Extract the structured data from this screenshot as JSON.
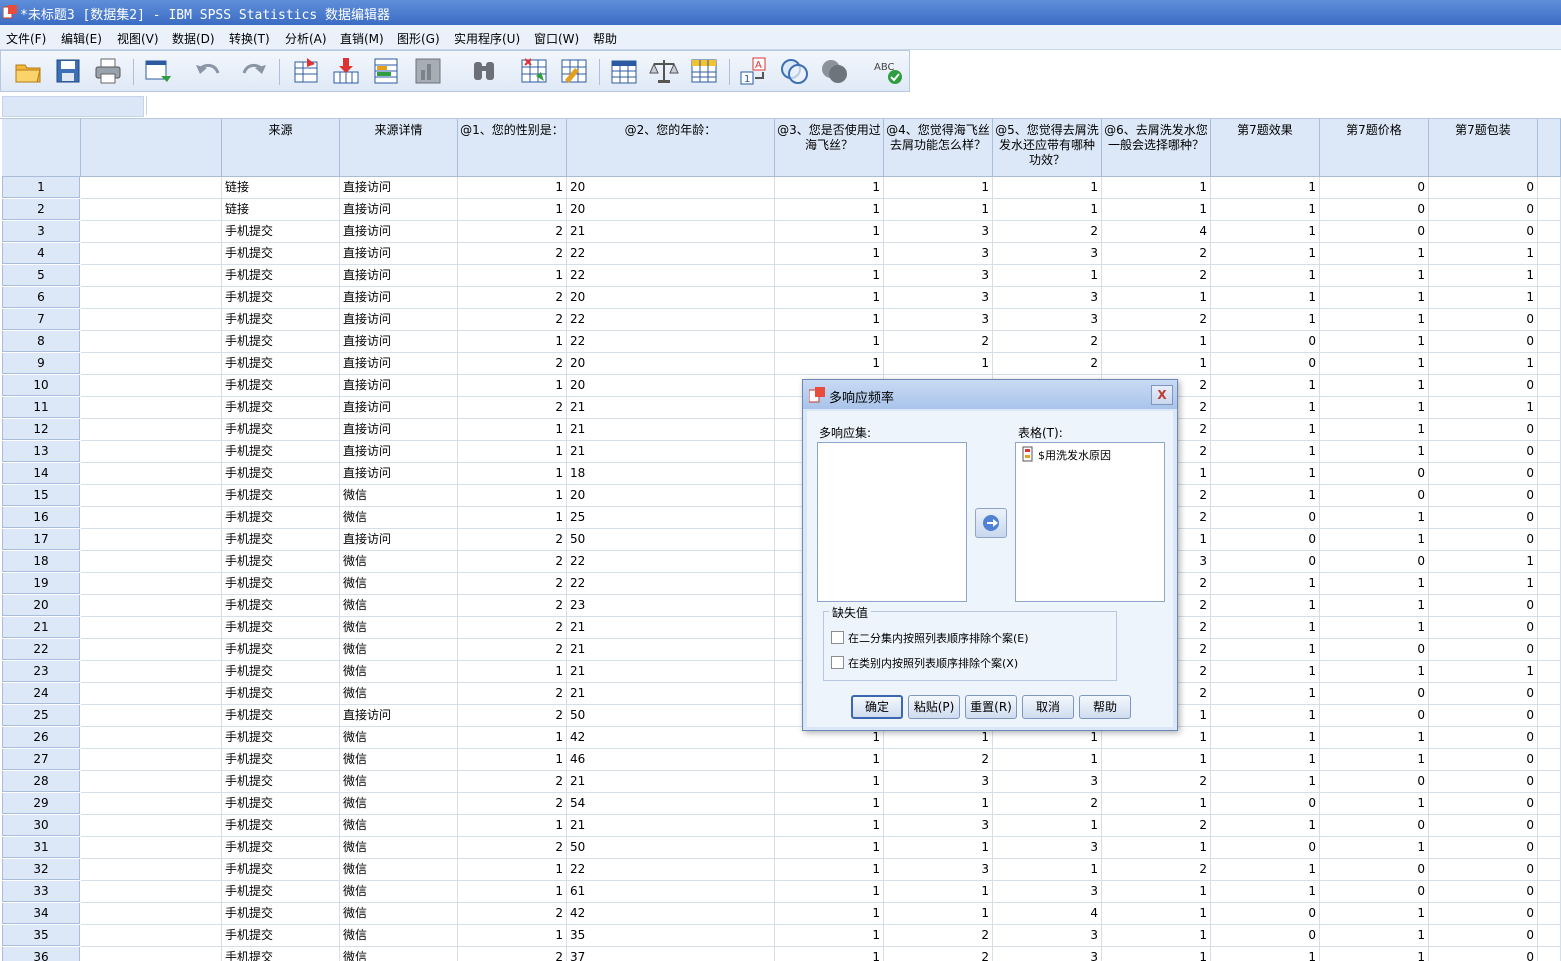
{
  "window": {
    "title": "*未标题3 [数据集2] - IBM SPSS Statistics 数据编辑器"
  },
  "menu": [
    "文件(F)",
    "编辑(E)",
    "视图(V)",
    "数据(D)",
    "转换(T)",
    "分析(A)",
    "直销(M)",
    "图形(G)",
    "实用程序(U)",
    "窗口(W)",
    "帮助"
  ],
  "toolbar_icons": [
    "open-folder-icon",
    "save-icon",
    "print-icon",
    "dialog-recall-icon",
    "undo-icon",
    "redo-icon",
    "goto-case-icon",
    "goto-variable-icon",
    "variables-icon",
    "run-descriptives-icon",
    "find-icon",
    "insert-cases-icon",
    "insert-variable-icon",
    "split-file-icon",
    "weight-cases-icon",
    "select-cases-icon",
    "value-labels-icon",
    "use-variable-sets-icon",
    "show-all-variables-icon",
    "spell-check-icon"
  ],
  "grid": {
    "columns": [
      "",
      "来源",
      "来源详情",
      "@1、您的性别是：",
      "@2、您的年龄：",
      "@3、您是否使用过海飞丝？",
      "@4、您觉得海飞丝去屑功能怎么样？",
      "@5、您觉得去屑洗发水还应带有哪种功效？",
      "@6、去屑洗发水您一般会选择哪种？",
      "第7题效果",
      "第7题价格",
      "第7题包装"
    ],
    "rows": [
      [
        "1",
        "",
        "链接",
        "直接访问",
        "1",
        "20",
        "1",
        "1",
        "1",
        "1",
        "1",
        "0",
        "0"
      ],
      [
        "2",
        "",
        "链接",
        "直接访问",
        "1",
        "20",
        "1",
        "1",
        "1",
        "1",
        "1",
        "0",
        "0"
      ],
      [
        "3",
        "",
        "手机提交",
        "直接访问",
        "2",
        "21",
        "1",
        "3",
        "2",
        "4",
        "1",
        "0",
        "0"
      ],
      [
        "4",
        "",
        "手机提交",
        "直接访问",
        "2",
        "22",
        "1",
        "3",
        "3",
        "2",
        "1",
        "1",
        "1"
      ],
      [
        "5",
        "",
        "手机提交",
        "直接访问",
        "1",
        "22",
        "1",
        "3",
        "1",
        "2",
        "1",
        "1",
        "1"
      ],
      [
        "6",
        "",
        "手机提交",
        "直接访问",
        "2",
        "20",
        "1",
        "3",
        "3",
        "1",
        "1",
        "1",
        "1"
      ],
      [
        "7",
        "",
        "手机提交",
        "直接访问",
        "2",
        "22",
        "1",
        "3",
        "3",
        "2",
        "1",
        "1",
        "0"
      ],
      [
        "8",
        "",
        "手机提交",
        "直接访问",
        "1",
        "22",
        "1",
        "2",
        "2",
        "1",
        "0",
        "1",
        "0"
      ],
      [
        "9",
        "",
        "手机提交",
        "直接访问",
        "2",
        "20",
        "1",
        "1",
        "2",
        "1",
        "0",
        "1",
        "1"
      ],
      [
        "10",
        "",
        "手机提交",
        "直接访问",
        "1",
        "20",
        "",
        "",
        "",
        "2",
        "1",
        "1",
        "0"
      ],
      [
        "11",
        "",
        "手机提交",
        "直接访问",
        "2",
        "21",
        "",
        "",
        "",
        "2",
        "1",
        "1",
        "1"
      ],
      [
        "12",
        "",
        "手机提交",
        "直接访问",
        "1",
        "21",
        "",
        "",
        "",
        "2",
        "1",
        "1",
        "0"
      ],
      [
        "13",
        "",
        "手机提交",
        "直接访问",
        "1",
        "21",
        "",
        "",
        "",
        "2",
        "1",
        "1",
        "0"
      ],
      [
        "14",
        "",
        "手机提交",
        "直接访问",
        "1",
        "18",
        "",
        "",
        "",
        "1",
        "1",
        "0",
        "0"
      ],
      [
        "15",
        "",
        "手机提交",
        "微信",
        "1",
        "20",
        "",
        "",
        "",
        "2",
        "1",
        "0",
        "0"
      ],
      [
        "16",
        "",
        "手机提交",
        "微信",
        "1",
        "25",
        "",
        "",
        "",
        "2",
        "0",
        "1",
        "0"
      ],
      [
        "17",
        "",
        "手机提交",
        "直接访问",
        "2",
        "50",
        "",
        "",
        "",
        "1",
        "0",
        "1",
        "0"
      ],
      [
        "18",
        "",
        "手机提交",
        "微信",
        "2",
        "22",
        "",
        "",
        "",
        "3",
        "0",
        "0",
        "1"
      ],
      [
        "19",
        "",
        "手机提交",
        "微信",
        "2",
        "22",
        "",
        "",
        "",
        "2",
        "1",
        "1",
        "1"
      ],
      [
        "20",
        "",
        "手机提交",
        "微信",
        "2",
        "23",
        "",
        "",
        "",
        "2",
        "1",
        "1",
        "0"
      ],
      [
        "21",
        "",
        "手机提交",
        "微信",
        "2",
        "21",
        "",
        "",
        "",
        "2",
        "1",
        "1",
        "0"
      ],
      [
        "22",
        "",
        "手机提交",
        "微信",
        "2",
        "21",
        "",
        "",
        "",
        "2",
        "1",
        "0",
        "0"
      ],
      [
        "23",
        "",
        "手机提交",
        "微信",
        "1",
        "21",
        "",
        "",
        "",
        "2",
        "1",
        "1",
        "1"
      ],
      [
        "24",
        "",
        "手机提交",
        "微信",
        "2",
        "21",
        "",
        "",
        "",
        "2",
        "1",
        "0",
        "0"
      ],
      [
        "25",
        "",
        "手机提交",
        "直接访问",
        "2",
        "50",
        "",
        "",
        "",
        "1",
        "1",
        "0",
        "0"
      ],
      [
        "26",
        "",
        "手机提交",
        "微信",
        "1",
        "42",
        "1",
        "1",
        "1",
        "1",
        "1",
        "1",
        "0"
      ],
      [
        "27",
        "",
        "手机提交",
        "微信",
        "1",
        "46",
        "1",
        "2",
        "1",
        "1",
        "1",
        "1",
        "0"
      ],
      [
        "28",
        "",
        "手机提交",
        "微信",
        "2",
        "21",
        "1",
        "3",
        "3",
        "2",
        "1",
        "0",
        "0"
      ],
      [
        "29",
        "",
        "手机提交",
        "微信",
        "2",
        "54",
        "1",
        "1",
        "2",
        "1",
        "0",
        "1",
        "0"
      ],
      [
        "30",
        "",
        "手机提交",
        "微信",
        "1",
        "21",
        "1",
        "3",
        "1",
        "2",
        "1",
        "0",
        "0"
      ],
      [
        "31",
        "",
        "手机提交",
        "微信",
        "2",
        "50",
        "1",
        "1",
        "3",
        "1",
        "0",
        "1",
        "0"
      ],
      [
        "32",
        "",
        "手机提交",
        "微信",
        "1",
        "22",
        "1",
        "3",
        "1",
        "2",
        "1",
        "0",
        "0"
      ],
      [
        "33",
        "",
        "手机提交",
        "微信",
        "1",
        "61",
        "1",
        "1",
        "3",
        "1",
        "1",
        "0",
        "0"
      ],
      [
        "34",
        "",
        "手机提交",
        "微信",
        "2",
        "42",
        "1",
        "1",
        "4",
        "1",
        "0",
        "1",
        "0"
      ],
      [
        "35",
        "",
        "手机提交",
        "微信",
        "1",
        "35",
        "1",
        "2",
        "3",
        "1",
        "0",
        "1",
        "0"
      ],
      [
        "36",
        "",
        "手机提交",
        "微信",
        "2",
        "37",
        "1",
        "2",
        "3",
        "1",
        "1",
        "1",
        "0"
      ]
    ]
  },
  "dialog": {
    "title": "多响应频率",
    "left_list_label": "多响应集:",
    "right_list_label": "表格(T):",
    "right_list_items": [
      "$用洗发水原因"
    ],
    "missing_group_label": "缺失值",
    "checkbox_dichotomy": "在二分集内按照列表顺序排除个案(E)",
    "checkbox_category": "在类别内按照列表顺序排除个案(X)",
    "buttons": {
      "ok": "确定",
      "paste": "粘贴(P)",
      "reset": "重置(R)",
      "cancel": "取消",
      "help": "帮助"
    },
    "close": "X"
  }
}
